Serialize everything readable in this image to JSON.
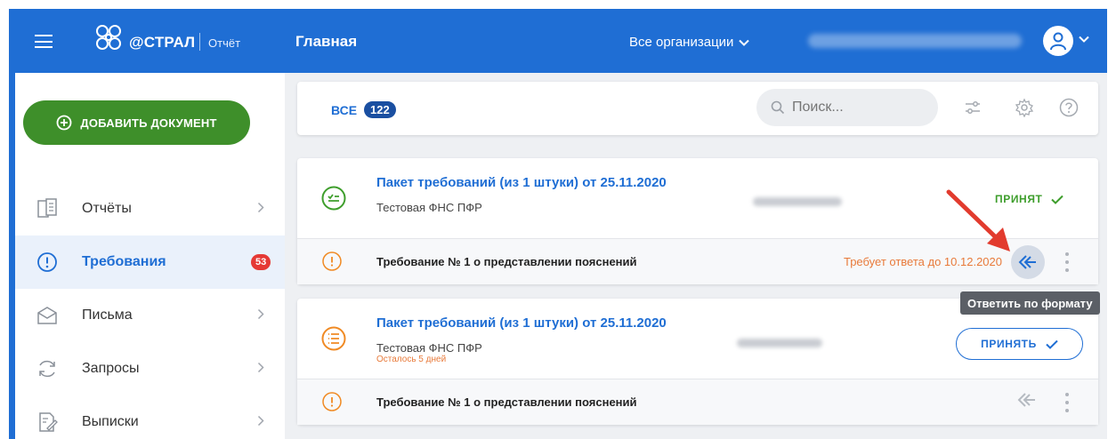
{
  "header": {
    "brand": "@СТРАЛ",
    "product": "Отчёт",
    "page_title": "Главная",
    "org_selector": "Все организации"
  },
  "sidebar": {
    "add_button": "ДОБАВИТЬ ДОКУМЕНТ",
    "items": [
      {
        "label": "Отчёты",
        "icon": "reports-icon"
      },
      {
        "label": "Требования",
        "icon": "alert-circle-icon",
        "badge": "53",
        "active": true
      },
      {
        "label": "Письма",
        "icon": "envelope-icon"
      },
      {
        "label": "Запросы",
        "icon": "refresh-icon"
      },
      {
        "label": "Выписки",
        "icon": "document-edit-icon"
      }
    ]
  },
  "toolbar": {
    "tab_all": "ВСЕ",
    "count": "122",
    "search_placeholder": "Поиск..."
  },
  "cards": [
    {
      "title": "Пакет требований (из 1 штуки) от 25.11.2020",
      "subtitle": "Тестовая ФНС ПФР",
      "status": "ПРИНЯТ",
      "row": {
        "text": "Требование № 1 о представлении пояснений",
        "deadline": "Требует ответа до 10.12.2020"
      }
    },
    {
      "title": "Пакет требований (из 1 штуки) от 25.11.2020",
      "subtitle": "Тестовая ФНС ПФР",
      "warning": "Осталось 5 дней",
      "action": "ПРИНЯТЬ",
      "row": {
        "text": "Требование № 1 о представлении пояснений"
      }
    }
  ],
  "tooltip": "Ответить по формату",
  "colors": {
    "primary": "#1f6ed4",
    "green": "#3e8f2a",
    "orange": "#f08a24",
    "badge_red": "#e53935"
  }
}
